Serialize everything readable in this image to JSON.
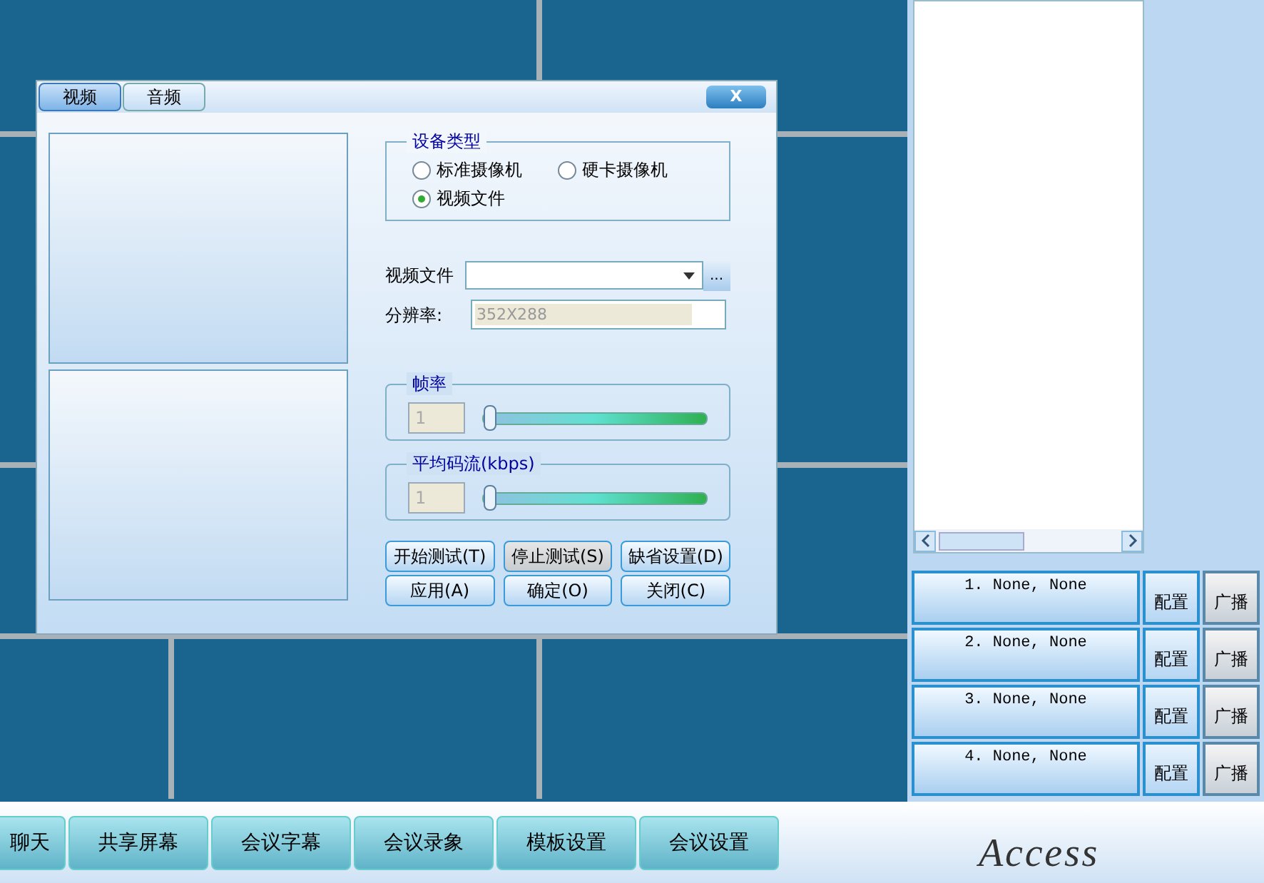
{
  "dialog": {
    "tabs": [
      {
        "label": "视频",
        "selected": true
      },
      {
        "label": "音频",
        "selected": false
      }
    ],
    "close": "X",
    "device_type": {
      "title": "设备类型",
      "options": [
        {
          "label": "标准摄像机",
          "selected": false
        },
        {
          "label": "硬卡摄像机",
          "selected": false
        },
        {
          "label": "视频文件",
          "selected": true
        }
      ]
    },
    "video_file": {
      "label": "视频文件",
      "browse": "..."
    },
    "resolution": {
      "label": "分辨率:",
      "value": "352X288",
      "disabled": true
    },
    "sliders": [
      {
        "title": "帧率",
        "value": "1",
        "disabled": true,
        "level": 0
      },
      {
        "title": "平均码流(kbps)",
        "value": "1",
        "disabled": true,
        "level": 0
      }
    ],
    "buttons": [
      {
        "label": "开始测试(T)",
        "pressed": false
      },
      {
        "label": "停止测试(S)",
        "pressed": true
      },
      {
        "label": "缺省设置(D)",
        "pressed": false
      },
      {
        "label": "应用(A)",
        "pressed": false
      },
      {
        "label": "确定(O)",
        "pressed": false
      },
      {
        "label": "关闭(C)",
        "pressed": false
      }
    ]
  },
  "participants": [
    {
      "name": "1. None, None",
      "config": "配置",
      "broadcast": "广播"
    },
    {
      "name": "2. None, None",
      "config": "配置",
      "broadcast": "广播"
    },
    {
      "name": "3. None, None",
      "config": "配置",
      "broadcast": "广播"
    },
    {
      "name": "4. None, None",
      "config": "配置",
      "broadcast": "广播"
    }
  ],
  "toolbar": [
    "聊天",
    "共享屏幕",
    "会议字幕",
    "会议录象",
    "模板设置",
    "会议设置"
  ],
  "brand": "Access"
}
